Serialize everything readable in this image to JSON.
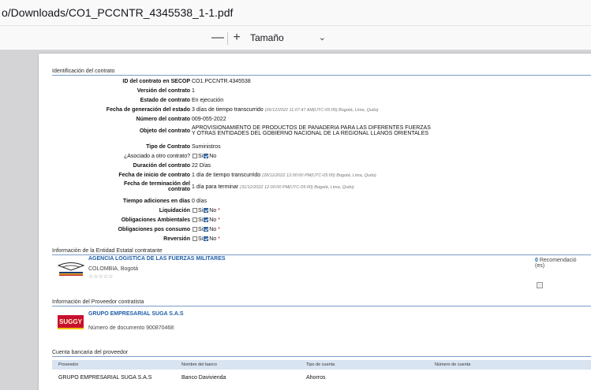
{
  "window": {
    "path": "o/Downloads/CO1_PCCNTR_4345538_1-1.pdf"
  },
  "toolbar": {
    "zoom_out": "—",
    "zoom_in": "+",
    "zoom_value": "Tamaño automático",
    "chevron": "⌄"
  },
  "contract": {
    "section_title": "Identificación del contrato",
    "rows": [
      {
        "label": "ID del contrato en SECOP",
        "value": "CO1.PCCNTR.4345538"
      },
      {
        "label": "Versión del contrato",
        "value": "1"
      },
      {
        "label": "Estado de contrato",
        "value": "En ejecución"
      },
      {
        "label": "Fecha de generación del estado",
        "value": "3 días de tiempo transcurrido",
        "note": "(26/12/2022 11:07:47 AM(UTC-05:00) Bogotá, Lima, Quito)"
      },
      {
        "label": "Número del contrato",
        "value": "009-055-2022"
      },
      {
        "label": "Objeto del contrato",
        "value": "APROVISIONAMIENTO DE PRODUCTOS DE PANADERIA PARA LAS DIFERENTES FUERZAS",
        "value2": "Y OTRAS ENTIDADES DEL GOBIERNO NACIONAL DE LA REGIONAL LLANOS ORIENTALES"
      },
      {
        "label": "Tipo de Contrato",
        "value": "Suministros"
      },
      {
        "label": "¿Asociado a otro contrato?",
        "si": "Si",
        "no": "No"
      },
      {
        "label": "Duración del contrato",
        "value": "22 Días"
      },
      {
        "label": "Fecha de inicio de contrato",
        "value": "1 día de tiempo transcurrido",
        "note": "(28/12/2022 12:00:00 PM(UTC-05:00) Bogotá, Lima, Quito)"
      },
      {
        "label": "Fecha de terminación del",
        "label2": "contrato",
        "value": "1 día para terminar",
        "note": "(31/12/2022 12:00:00 PM(UTC-05:00) Bogotá, Lima, Quito)"
      },
      {
        "label": "Tiempo adiciones en días",
        "value": "0 días"
      },
      {
        "label": "Liquidación",
        "si": "Si",
        "no": "No",
        "req": "*"
      },
      {
        "label": "Obligaciones Ambientales",
        "si": "Si",
        "no": "No",
        "req": "*"
      },
      {
        "label": "Obligaciones pos consumo",
        "si": "Si",
        "no": "No",
        "req": "*"
      },
      {
        "label": "Reversión",
        "si": "Si",
        "no": "No",
        "req": "*"
      }
    ]
  },
  "entity": {
    "section_title": "Información de la Entidad Estatal contratante",
    "name": "AGENCIA LOGISTICA DE LAS FUERZAS MILITARES",
    "location": "COLOMBIA, Bogotá",
    "stars": "☆☆☆☆☆",
    "rec_count": "0",
    "rec_label": "Recomendació",
    "rec_label2": "(es)"
  },
  "provider": {
    "section_title": "Información del Proveedor contratista",
    "name": "GRUPO EMPRESARIAL SUGA S.A.S",
    "doc": "Número de documento 900870468",
    "logo_text": "SUGGY"
  },
  "bank": {
    "section_title": "Cuenta bancaria del proveedor",
    "headers": [
      "Proveedor",
      "Nombre del banco",
      "Tipo de cuenta",
      "Número de cuenta"
    ],
    "row": [
      "GRUPO EMPRESARIAL SUGA S.A.S",
      "Banco Davivienda",
      "Ahorros",
      ""
    ]
  }
}
